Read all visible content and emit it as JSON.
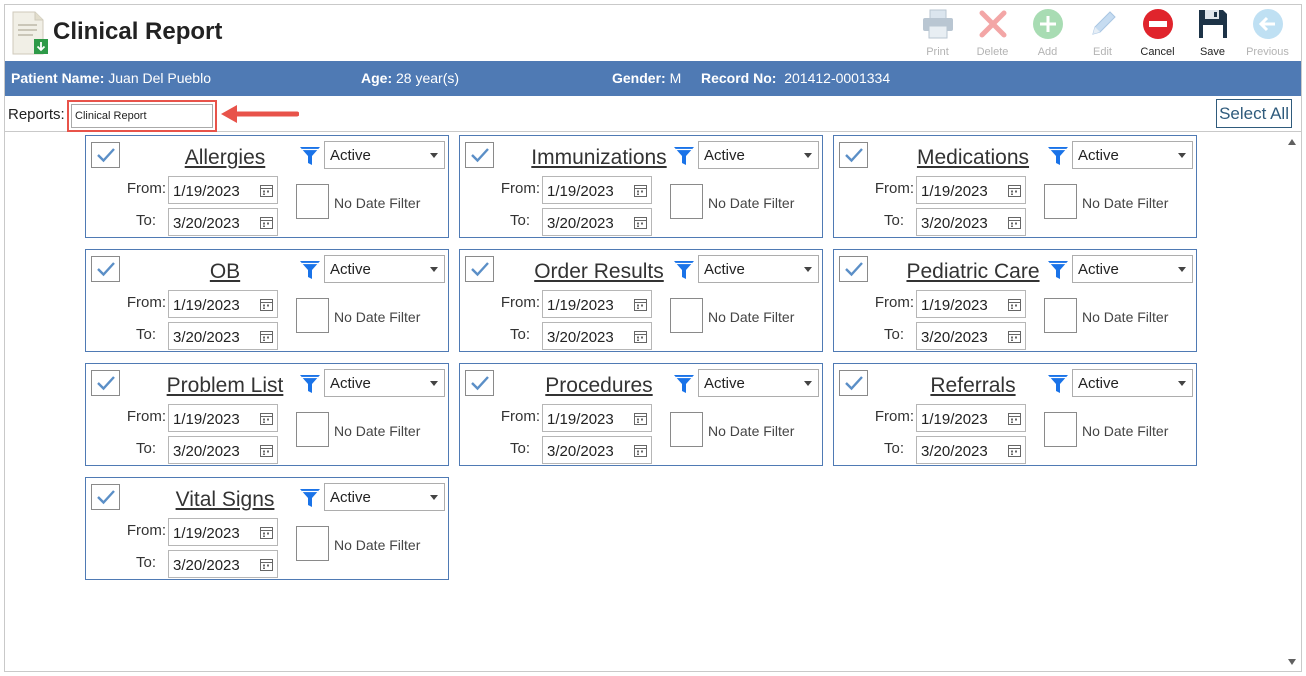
{
  "header": {
    "title": "Clinical Report",
    "icon": "document-download-icon",
    "toolbar": [
      {
        "name": "print-button",
        "icon": "printer-icon",
        "label": "Print",
        "disabled": true
      },
      {
        "name": "delete-button",
        "icon": "close-icon",
        "label": "Delete",
        "disabled": true
      },
      {
        "name": "add-button",
        "icon": "plus-circle-icon",
        "label": "Add",
        "disabled": true
      },
      {
        "name": "edit-button",
        "icon": "pencil-icon",
        "label": "Edit",
        "disabled": true
      },
      {
        "name": "cancel-button",
        "icon": "minus-circle-icon",
        "label": "Cancel",
        "disabled": false
      },
      {
        "name": "save-button",
        "icon": "floppy-disk-icon",
        "label": "Save",
        "disabled": false
      },
      {
        "name": "previous-button",
        "icon": "arrow-left-circle-icon",
        "label": "Previous",
        "disabled": true
      }
    ]
  },
  "patient": {
    "name_label": "Patient Name:",
    "name": "Juan Del Pueblo",
    "age_label": "Age:",
    "age": "28 year(s)",
    "gender_label": "Gender:",
    "gender": "M",
    "record_label": "Record No:",
    "record": "201412-0001334"
  },
  "reports": {
    "label": "Reports:",
    "value": "Clinical Report",
    "select_all_label": "Select All"
  },
  "colors": {
    "patient_bar": "#4f7ab4",
    "callout": "#e8534a",
    "filter_icon": "#1a73e8",
    "checkmark": "#5b8fc7",
    "card_border": "#4f7ab4"
  },
  "cards": [
    {
      "title": "Allergies",
      "checked": true,
      "status": "Active",
      "from_label": "From:",
      "from": "1/19/2023",
      "to_label": "To:",
      "to": "3/20/2023",
      "no_date_filter_label": "No Date Filter",
      "no_date_filter": false
    },
    {
      "title": "Immunizations",
      "checked": true,
      "status": "Active",
      "from_label": "From:",
      "from": "1/19/2023",
      "to_label": "To:",
      "to": "3/20/2023",
      "no_date_filter_label": "No Date Filter",
      "no_date_filter": false
    },
    {
      "title": "Medications",
      "checked": true,
      "status": "Active",
      "from_label": "From:",
      "from": "1/19/2023",
      "to_label": "To:",
      "to": "3/20/2023",
      "no_date_filter_label": "No Date Filter",
      "no_date_filter": false
    },
    {
      "title": "OB",
      "checked": true,
      "status": "Active",
      "from_label": "From:",
      "from": "1/19/2023",
      "to_label": "To:",
      "to": "3/20/2023",
      "no_date_filter_label": "No Date Filter",
      "no_date_filter": false
    },
    {
      "title": "Order Results",
      "checked": true,
      "status": "Active",
      "from_label": "From:",
      "from": "1/19/2023",
      "to_label": "To:",
      "to": "3/20/2023",
      "no_date_filter_label": "No Date Filter",
      "no_date_filter": false
    },
    {
      "title": "Pediatric Care",
      "checked": true,
      "status": "Active",
      "from_label": "From:",
      "from": "1/19/2023",
      "to_label": "To:",
      "to": "3/20/2023",
      "no_date_filter_label": "No Date Filter",
      "no_date_filter": false
    },
    {
      "title": "Problem List",
      "checked": true,
      "status": "Active",
      "from_label": "From:",
      "from": "1/19/2023",
      "to_label": "To:",
      "to": "3/20/2023",
      "no_date_filter_label": "No Date Filter",
      "no_date_filter": false
    },
    {
      "title": "Procedures",
      "checked": true,
      "status": "Active",
      "from_label": "From:",
      "from": "1/19/2023",
      "to_label": "To:",
      "to": "3/20/2023",
      "no_date_filter_label": "No Date Filter",
      "no_date_filter": false
    },
    {
      "title": "Referrals",
      "checked": true,
      "status": "Active",
      "from_label": "From:",
      "from": "1/19/2023",
      "to_label": "To:",
      "to": "3/20/2023",
      "no_date_filter_label": "No Date Filter",
      "no_date_filter": false
    },
    {
      "title": "Vital Signs",
      "checked": true,
      "status": "Active",
      "from_label": "From:",
      "from": "1/19/2023",
      "to_label": "To:",
      "to": "3/20/2023",
      "no_date_filter_label": "No Date Filter",
      "no_date_filter": false
    }
  ]
}
